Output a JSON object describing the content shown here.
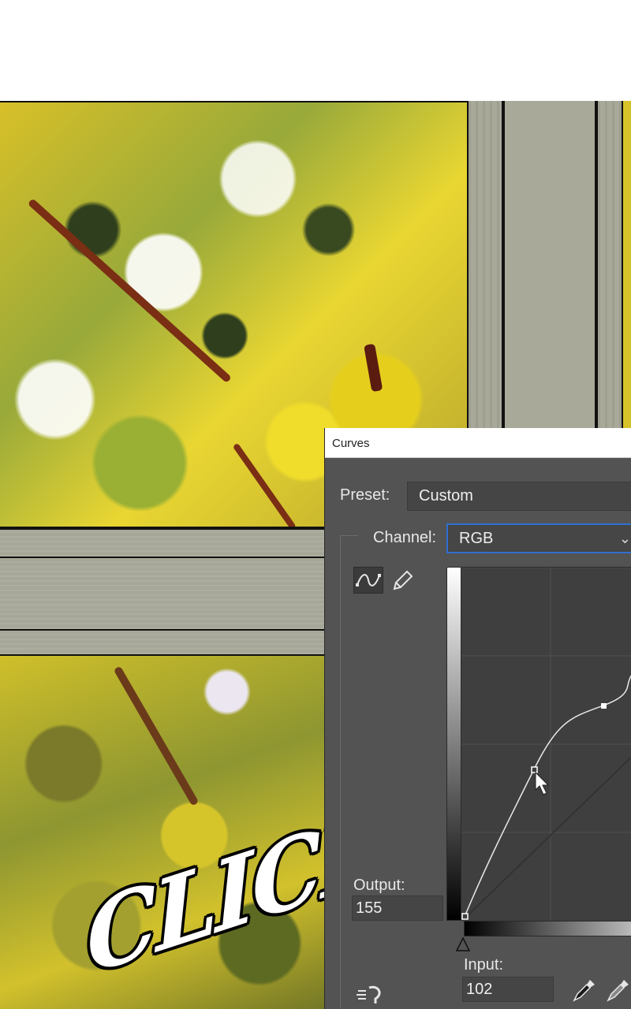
{
  "dialog": {
    "title": "Curves",
    "preset_label": "Preset:",
    "preset_value": "Custom",
    "channel_label": "Channel:",
    "channel_value": "RGB",
    "output_label": "Output:",
    "output_value": "155",
    "input_label": "Input:",
    "input_value": "102"
  },
  "overlay": {
    "sound_effect": "CLICK"
  },
  "icons": {
    "curve_tool": "curve-edit-icon",
    "pencil_tool": "pencil-icon",
    "auto_smooth": "auto-icon",
    "black_eyedropper": "eyedropper-black-icon",
    "gray_eyedropper": "eyedropper-gray-icon",
    "dropdown": "chevron-down-icon"
  },
  "colors": {
    "dialog_bg": "#535353",
    "focus_blue": "#2e6fd1",
    "graph_bg": "#3f3f3f"
  }
}
